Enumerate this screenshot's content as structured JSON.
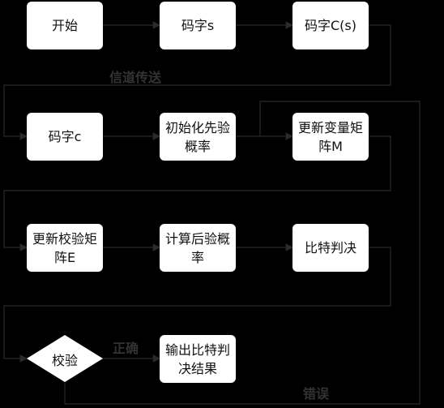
{
  "nodes": {
    "start": "开始",
    "codeword_s": "码字s",
    "codeword_cs": "码字C(s)",
    "codeword_c": "码字c",
    "init_prior": "初始化先验概率",
    "update_m": "更新变量矩阵M",
    "update_e": "更新校验矩阵E",
    "posterior": "计算后验概率",
    "bit_decision": "比特判决",
    "check": "校验",
    "output": "输出比特判决结果"
  },
  "edge_labels": {
    "channel": "信道传送",
    "correct": "正确",
    "wrong": "错误"
  },
  "colors": {
    "background": "#000000",
    "node": "#ffffff",
    "line": "#2a2a2a",
    "label": "#333333"
  }
}
